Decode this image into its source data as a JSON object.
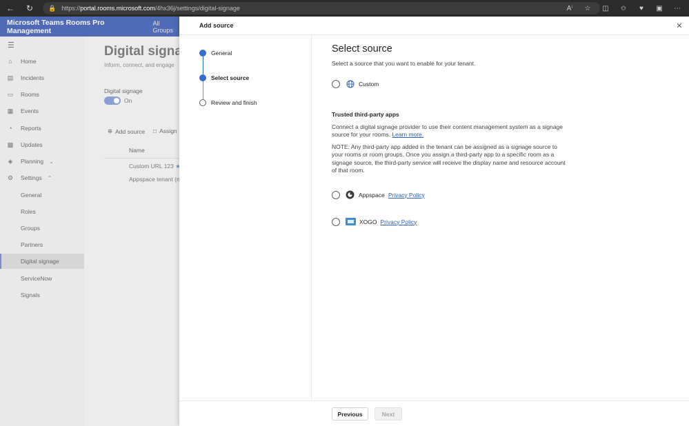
{
  "browser": {
    "url_prefix": "https://",
    "url_host": "portal.rooms.microsoft.com",
    "url_path": "/4hx36j/settings/digital-signage"
  },
  "app": {
    "title": "Microsoft Teams Rooms Pro Management",
    "group_selector": "All Groups"
  },
  "leftnav": {
    "items": [
      {
        "label": "Home",
        "icon": "home-icon"
      },
      {
        "label": "Incidents",
        "icon": "incidents-icon"
      },
      {
        "label": "Rooms",
        "icon": "rooms-icon"
      },
      {
        "label": "Events",
        "icon": "calendar-icon"
      },
      {
        "label": "Reports",
        "icon": "reports-icon"
      },
      {
        "label": "Updates",
        "icon": "updates-icon"
      },
      {
        "label": "Planning",
        "icon": "planning-icon"
      },
      {
        "label": "Settings",
        "icon": "gear-icon"
      }
    ],
    "settings_sub": [
      "General",
      "Roles",
      "Groups",
      "Partners",
      "Digital signage",
      "ServiceNow",
      "Signals"
    ]
  },
  "page": {
    "title": "Digital signage",
    "subtitle": "Inform, connect, and engage",
    "toggle_label": "Digital signage",
    "toggle_state": "On",
    "cmd_add": "Add source",
    "cmd_assign": "Assign",
    "col_name": "Name",
    "rows": [
      "Custom URL 123",
      "Appspace tenant (n"
    ]
  },
  "panel": {
    "title": "Add source",
    "steps": [
      "General",
      "Select source",
      "Review and finish"
    ],
    "heading": "Select source",
    "description": "Select a source that you want to enable for your tenant.",
    "custom_option": "Custom",
    "section_title": "Trusted third-party apps",
    "connect_text": "Connect a digital signage provider to use their content management system as a signage source for your rooms.",
    "learn_more": "Learn more.",
    "note_text": "NOTE: Any third-party app added in the tenant can be assigned as a signage source to your rooms or room groups. Once you assign a third-party app to a specific room as a signage source, the third-party service will receive the display name and resource account of that room.",
    "apps": [
      {
        "name": "Appspace",
        "link": "Privacy Policy",
        "icon": "appspace-icon"
      },
      {
        "name": "XOGO",
        "link": "Privacy Policy",
        "icon": "xogo-icon"
      }
    ],
    "btn_previous": "Previous",
    "btn_next": "Next"
  },
  "colors": {
    "accent": "#2f6fcf",
    "header_bg": "#4f6bb7",
    "link": "#2f5eb8"
  }
}
